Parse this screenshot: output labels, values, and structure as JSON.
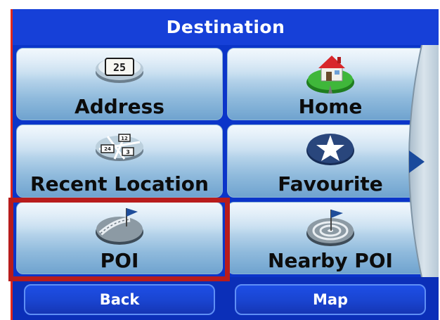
{
  "header": {
    "title": "Destination"
  },
  "tiles": [
    {
      "label": "Address",
      "icon": "address-plate-icon",
      "plate_number": "25"
    },
    {
      "label": "Home",
      "icon": "home-icon"
    },
    {
      "label": "Recent Location",
      "icon": "recent-location-map-icon",
      "map_numbers": [
        "12",
        "24",
        "3"
      ]
    },
    {
      "label": "Favourite",
      "icon": "star-icon"
    },
    {
      "label": "POI",
      "icon": "poi-flag-icon"
    },
    {
      "label": "Nearby POI",
      "icon": "nearby-poi-radar-icon"
    }
  ],
  "side_panel": {
    "icon": "next-page-arrow-icon"
  },
  "footer": {
    "back_label": "Back",
    "map_label": "Map"
  },
  "colors": {
    "frame_blue": "#1640d8",
    "highlight_red": "#b81c1c",
    "arrow": "#1a4a9c"
  }
}
